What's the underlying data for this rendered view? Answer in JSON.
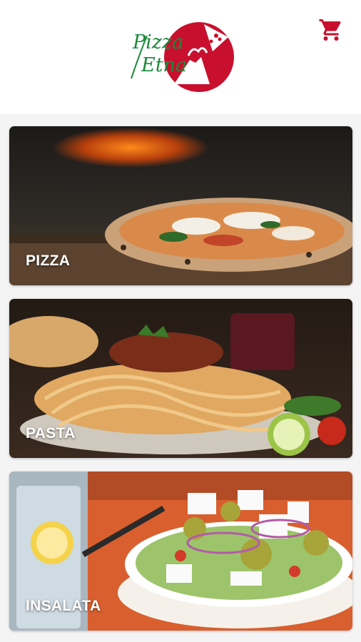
{
  "brand": {
    "logo_line1": "Pizza",
    "logo_line2": "Etna",
    "red": "#c8102e",
    "green": "#1a8a3a"
  },
  "icons": {
    "cart": "shopping-cart-icon"
  },
  "categories": [
    {
      "label": "PIZZA"
    },
    {
      "label": "PASTA"
    },
    {
      "label": "INSALATA"
    }
  ]
}
